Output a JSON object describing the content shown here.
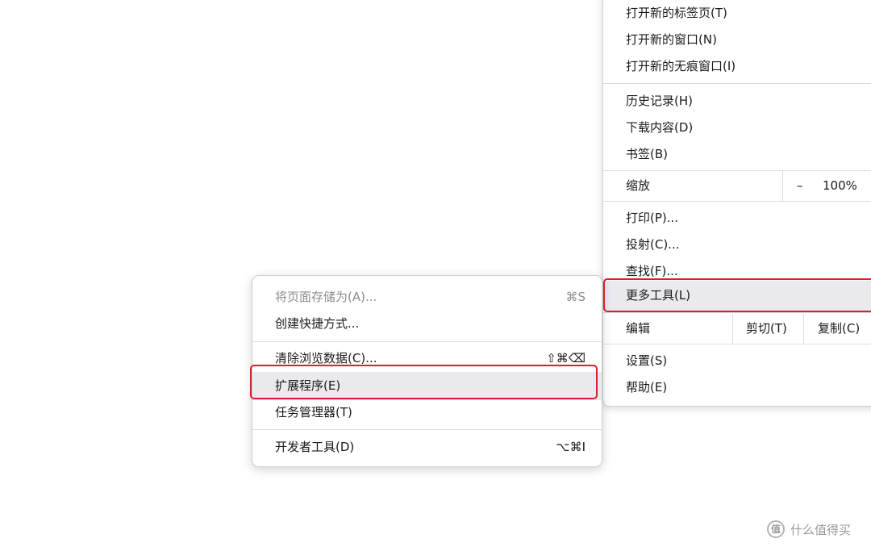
{
  "main_menu": {
    "new_tab": "打开新的标签页(T)",
    "new_window": "打开新的窗口(N)",
    "new_incognito": "打开新的无痕窗口(I)",
    "history": "历史记录(H)",
    "downloads": "下载内容(D)",
    "bookmarks": "书签(B)",
    "zoom_label": "缩放",
    "zoom_minus": "–",
    "zoom_value": "100%",
    "print": "打印(P)...",
    "cast": "投射(C)...",
    "find": "查找(F)...",
    "more_tools": "更多工具(L)",
    "edit_label": "编辑",
    "cut": "剪切(T)",
    "copy": "复制(C)",
    "settings": "设置(S)",
    "help": "帮助(E)"
  },
  "sub_menu": {
    "save_page": "将页面存储为(A)...",
    "save_page_shortcut": "⌘S",
    "create_shortcut": "创建快捷方式...",
    "clear_data": "清除浏览数据(C)...",
    "clear_data_shortcut": "⇧⌘⌫",
    "extensions": "扩展程序(E)",
    "task_manager": "任务管理器(T)",
    "dev_tools": "开发者工具(D)",
    "dev_tools_shortcut": "⌥⌘I"
  },
  "watermark": {
    "logo_glyph": "值",
    "text": "什么值得买"
  },
  "colors": {
    "highlight_border": "#d8202a",
    "highlight_background": "#e9e9ee",
    "disabled_text": "#8c8c8c"
  }
}
